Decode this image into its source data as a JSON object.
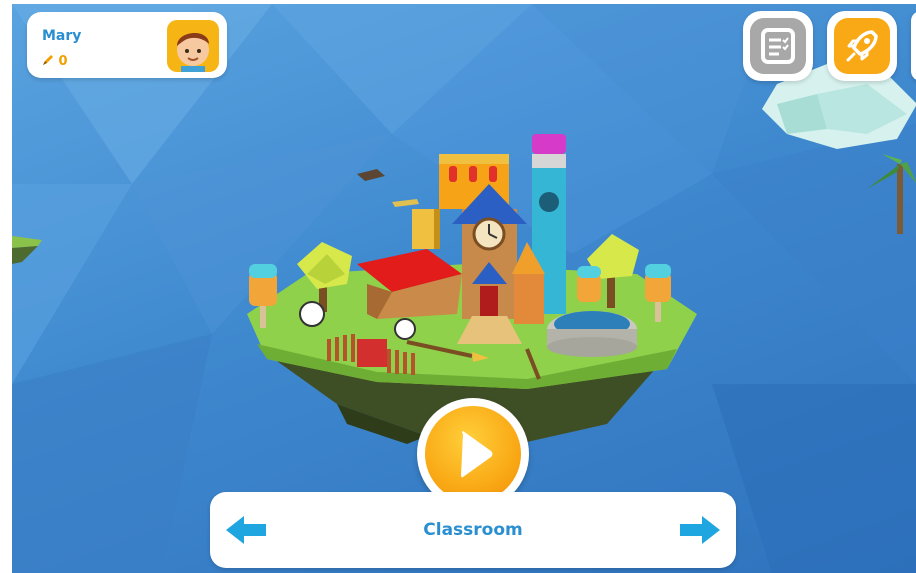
{
  "player": {
    "name": "Mary",
    "score": "0",
    "score_icon": "pencil-icon",
    "avatar_icon": "boy-avatar-icon"
  },
  "toolbar": {
    "tasks_icon": "checklist-icon",
    "rocket_icon": "rocket-icon"
  },
  "level": {
    "name": "Classroom",
    "prev_icon": "arrow-left-icon",
    "next_icon": "arrow-right-icon",
    "play_icon": "play-icon"
  },
  "colors": {
    "accent_blue": "#2a8fd1",
    "gold": "#f9a915",
    "arrow": "#1fa6e0",
    "sky": "#3f89cf"
  }
}
